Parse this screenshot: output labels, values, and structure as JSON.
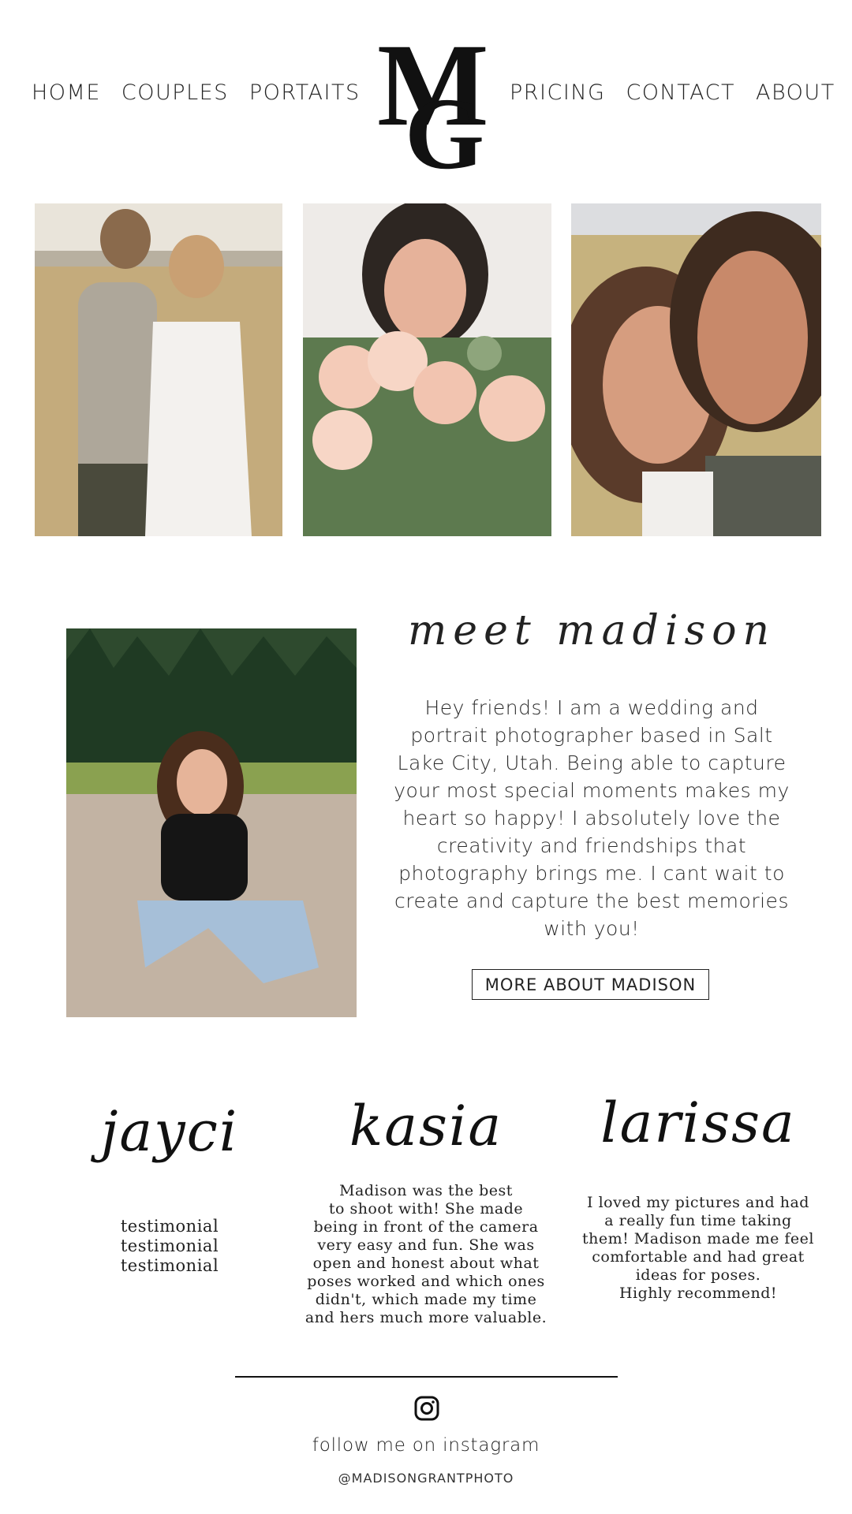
{
  "nav": {
    "left": [
      "HOME",
      "COUPLES",
      "PORTAITS"
    ],
    "right": [
      "PRICING",
      "CONTACT",
      "ABOUT"
    ]
  },
  "logo": {
    "letters": "MG"
  },
  "about": {
    "title": "meet madison",
    "bio": "Hey friends! I am a wedding and portrait photographer based in Salt Lake City, Utah. Being able to capture your most special moments makes my heart so happy! I absolutely love the creativity and friendships that photography brings me. I cant wait to create and capture the best memories with you!",
    "button": "MORE ABOUT MADISON"
  },
  "testimonials": [
    {
      "name": "jayci",
      "quote": "testimonial\ntestimonial\ntestimonial"
    },
    {
      "name": "kasia",
      "quote": "Madison was the best\nto shoot with! She made\nbeing in front of the camera\nvery easy and fun. She was\nopen and honest about what\nposes worked and which ones\ndidn't, which made my time\nand hers much more valuable."
    },
    {
      "name": "larissa",
      "quote": "I loved my pictures and had\na really fun time taking\nthem! Madison made me feel\ncomfortable and had great\nideas for poses.\nHighly recommend!"
    }
  ],
  "footer": {
    "icon": "instagram-icon",
    "follow": "follow me on instagram",
    "handle": "@MADISONGRANTPHOTO"
  }
}
